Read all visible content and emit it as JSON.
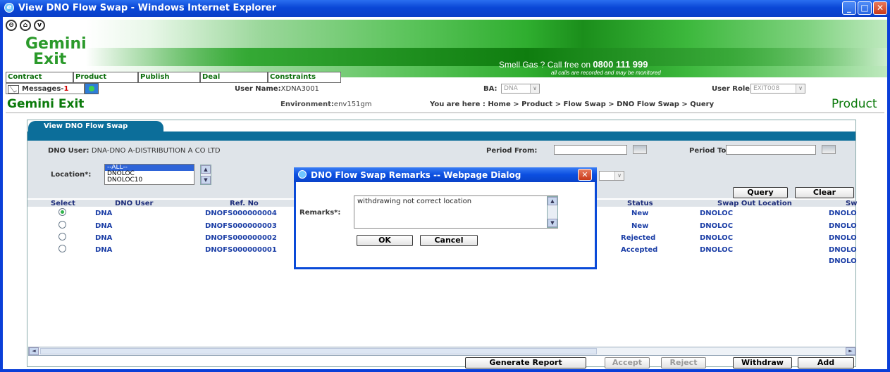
{
  "window": {
    "title": "View DNO Flow Swap - Windows Internet Explorer"
  },
  "header": {
    "logo_line1": "Gemini",
    "logo_line2": "Exit",
    "banner_smell": "Smell Gas ? Call free on",
    "banner_phone": "0800 111 999",
    "banner_sub": "all calls are recorded and may be monitored"
  },
  "menu": [
    "Contract",
    "Product",
    "Publish",
    "Deal",
    "Constraints"
  ],
  "info": {
    "messages_label": "Messages-",
    "messages_count": "1",
    "user_name_label": "User Name:",
    "user_name": "XDNA3001",
    "ba_label": "BA:",
    "ba_value": "DNA",
    "user_role_label": "User Role:",
    "user_role_value": "EXIT008"
  },
  "page": {
    "app_title": "Gemini Exit",
    "env_label": "Environment:",
    "env_value": "env151gm",
    "breadcrumb": "You are here : Home > Product > Flow Swap > DNO Flow Swap > Query",
    "section": "Product",
    "tab": "View DNO Flow Swap"
  },
  "filters": {
    "dno_user_label": "DNO User:",
    "dno_user_value": "DNA-DNO A-DISTRIBUTION A CO LTD",
    "period_from_label": "Period From:",
    "period_to_label": "Period To:",
    "location_label": "Location*:",
    "location_options": [
      "--ALL--",
      "DNOLOC",
      "DNOLOC10"
    ],
    "query_button": "Query",
    "clear_button": "Clear"
  },
  "table": {
    "headers": [
      "Select",
      "DNO User",
      "Ref. No",
      "Status",
      "Swap Out Location",
      "Sw"
    ],
    "rows": [
      {
        "selected": true,
        "dno_user": "DNA",
        "ref": "DNOFS000000004",
        "status": "New",
        "swap_out": "DNOLOC",
        "swap_in": "DNOLO"
      },
      {
        "selected": false,
        "dno_user": "DNA",
        "ref": "DNOFS000000003",
        "status": "New",
        "swap_out": "DNOLOC",
        "swap_in": "DNOLO"
      },
      {
        "selected": false,
        "dno_user": "DNA",
        "ref": "DNOFS000000002",
        "status": "Rejected",
        "swap_out": "DNOLOC",
        "swap_in": "DNOLO"
      },
      {
        "selected": false,
        "dno_user": "DNA",
        "ref": "DNOFS000000001",
        "status": "Accepted",
        "swap_out": "DNOLOC",
        "swap_in": "DNOLO"
      }
    ],
    "extra_swap_in": "DNOLO"
  },
  "actions": {
    "generate_report": "Generate Report",
    "accept": "Accept",
    "reject": "Reject",
    "withdraw": "Withdraw",
    "add": "Add"
  },
  "dialog": {
    "title": "DNO Flow Swap Remarks -- Webpage Dialog",
    "remarks_label": "Remarks*:",
    "remarks_value": "withdrawing not correct location",
    "ok": "OK",
    "cancel": "Cancel"
  }
}
